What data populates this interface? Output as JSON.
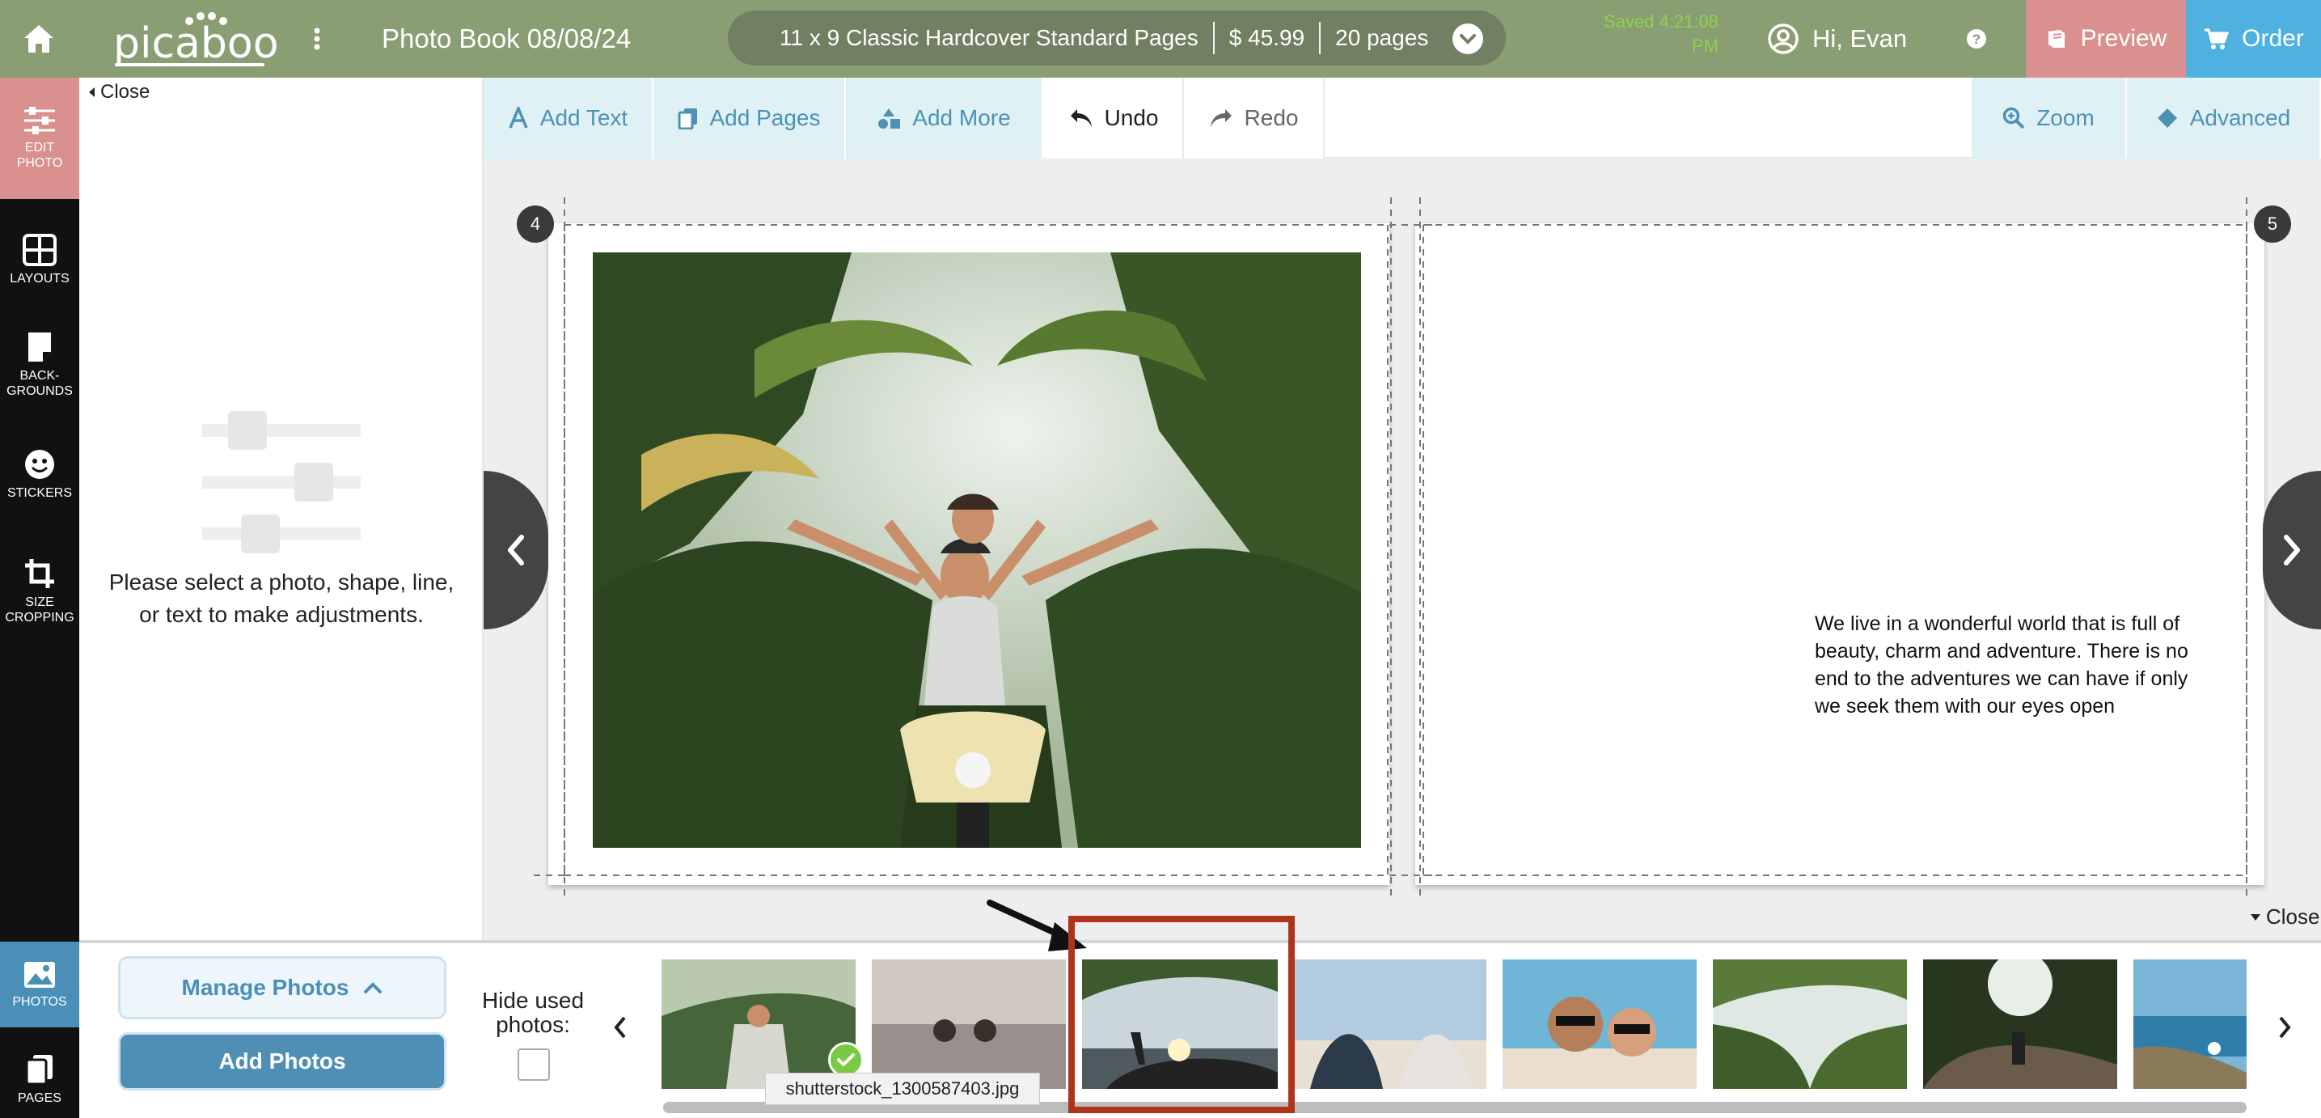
{
  "header": {
    "logo": "picaboo",
    "title": "Photo Book 08/08/24",
    "product": "11 x 9 Classic Hardcover Standard Pages",
    "price": "$ 45.99",
    "pages": "20 pages",
    "saved_line1": "Saved 4:21:08",
    "saved_line2": "PM",
    "user": "Hi, Evan",
    "preview": "Preview",
    "order": "Order"
  },
  "rail": {
    "edit_photo_1": "EDIT",
    "edit_photo_2": "PHOTO",
    "layouts": "LAYOUTS",
    "backgrounds_1": "BACK-",
    "backgrounds_2": "GROUNDS",
    "stickers": "STICKERS",
    "size_1": "SIZE",
    "size_2": "CROPPING",
    "photos": "PHOTOS",
    "pages": "PAGES"
  },
  "panel": {
    "close": "Close",
    "message": "Please select a photo, shape, line, or text to make adjustments."
  },
  "toolbar": {
    "add_text": "Add Text",
    "add_pages": "Add Pages",
    "add_more": "Add More",
    "undo": "Undo",
    "redo": "Redo",
    "zoom": "Zoom",
    "advanced": "Advanced"
  },
  "canvas": {
    "left_page_number": "4",
    "right_page_number": "5",
    "text_block": "We live in a wonderful world that is full of beauty, charm and adventure. There is no end to the adventures we can have if only we seek them with our eyes open",
    "close": "Close"
  },
  "tray": {
    "manage_photos": "Manage Photos",
    "add_photos": "Add Photos",
    "hide_used_1": "Hide used",
    "hide_used_2": "photos:",
    "tooltip": "shutterstock_1300587403.jpg"
  },
  "colors": {
    "header_bg": "#8a9e74",
    "preview_bg": "#d9908f",
    "order_bg": "#4eb1df",
    "accent_blue": "#4f8fb6",
    "highlight_red": "#b0341c"
  }
}
